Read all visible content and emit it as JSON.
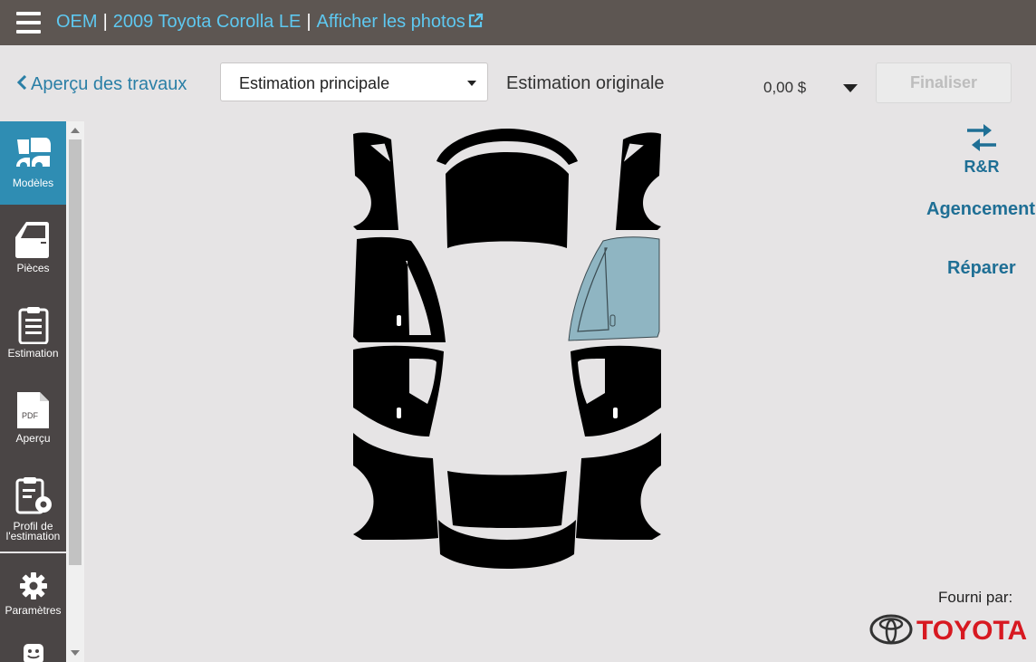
{
  "header": {
    "oem_label": "OEM",
    "separator": "|",
    "vehicle": "2009 Toyota Corolla LE",
    "photos_link": "Afficher les photos"
  },
  "toolbar": {
    "back_label": "Aperçu des travaux",
    "estimate_select_value": "Estimation principale",
    "original_label": "Estimation originale",
    "amount": "0,00 $",
    "finalize_label": "Finaliser"
  },
  "sidebar": {
    "items": [
      {
        "label": "Modèles",
        "icon": "car-models-icon",
        "active": true
      },
      {
        "label": "Pièces",
        "icon": "door-part-icon"
      },
      {
        "label": "Estimation",
        "icon": "clipboard-icon"
      },
      {
        "label": "Aperçu",
        "icon": "pdf-file-icon",
        "icon_text": "PDF"
      },
      {
        "label": "Profil de l'estimation",
        "line1": "Profil de",
        "line2": "l'estimation",
        "icon": "clipboard-gear-icon"
      },
      {
        "label": "Paramètres",
        "icon": "gear-icon"
      },
      {
        "label": "",
        "icon": "smiley-icon"
      }
    ]
  },
  "tools": {
    "rr_label": "R&R",
    "layout_label": "Agencement",
    "repair_label": "Réparer"
  },
  "footer": {
    "provided_by": "Fourni par:",
    "brand": "TOYOTA"
  },
  "colors": {
    "topbar": "#5d5652",
    "link": "#5ec8f0",
    "accent": "#2f8db3",
    "action_text": "#1f6f95",
    "selected_panel": "#8fb5c2",
    "panel": "#000000",
    "brand_red": "#d71921"
  },
  "diagram": {
    "selected_panel": "right-front-door"
  }
}
